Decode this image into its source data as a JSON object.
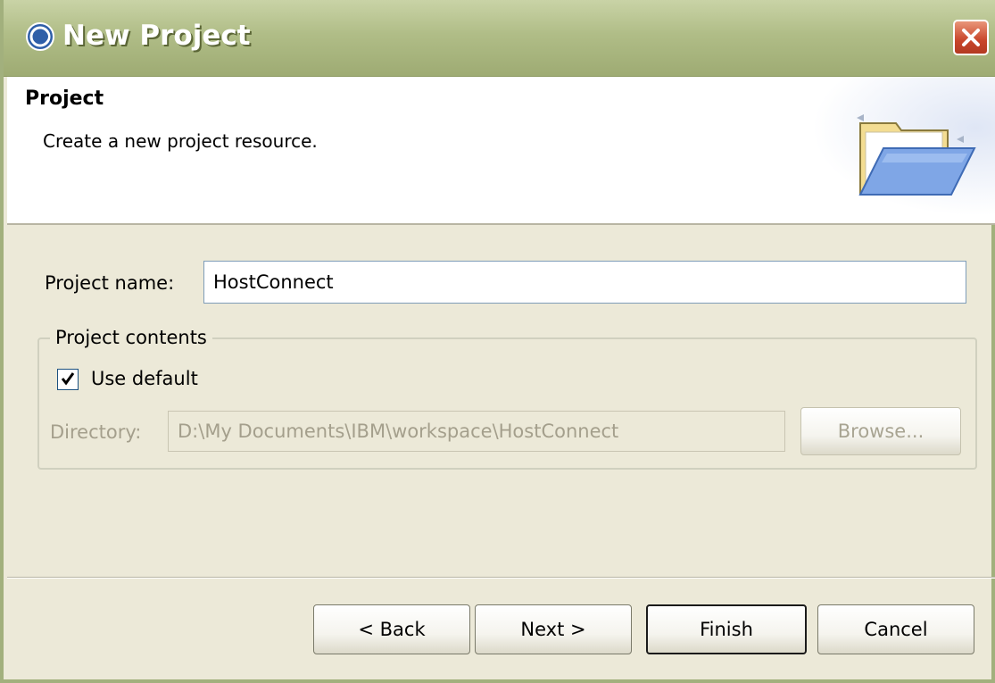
{
  "window": {
    "title": "New Project"
  },
  "header": {
    "title": "Project",
    "description": "Create a new project resource."
  },
  "form": {
    "project_name_label": "Project name:",
    "project_name_value": "HostConnect",
    "group_title": "Project contents",
    "use_default_label": "Use default",
    "use_default_checked": true,
    "directory_label": "Directory:",
    "directory_value": "D:\\My Documents\\IBM\\workspace\\HostConnect",
    "browse_label": "Browse..."
  },
  "buttons": {
    "back": "< Back",
    "next": "Next >",
    "finish": "Finish",
    "cancel": "Cancel"
  },
  "icons": {
    "title_icon": "eclipse-icon",
    "close_icon": "close-icon",
    "header_icon": "open-folder-icon",
    "checkbox_mark": "check-icon"
  },
  "colors": {
    "titlebar": "#b0bd87",
    "close_button": "#c8452a",
    "dialog_background": "#ece9d8"
  }
}
